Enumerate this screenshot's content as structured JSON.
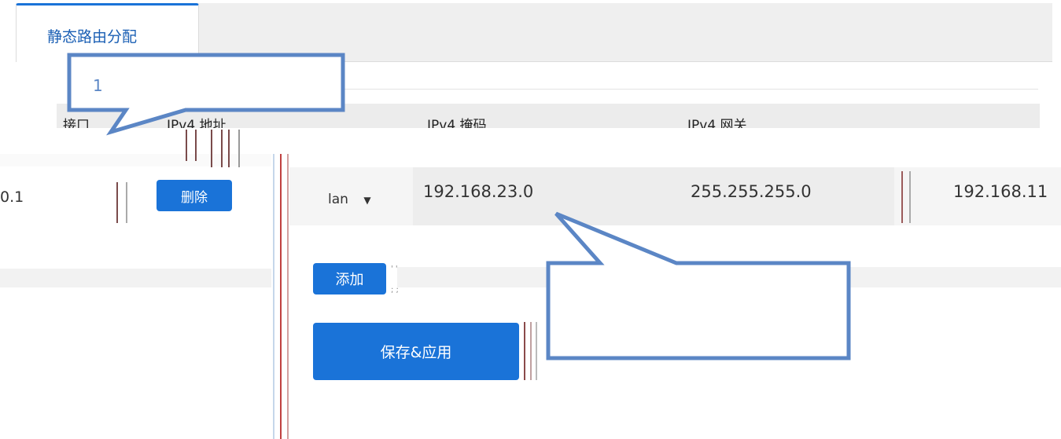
{
  "tabs": [
    {
      "label": "静态路由分配",
      "active": true
    }
  ],
  "table": {
    "headers": [
      "接口",
      "IPv4 地址",
      "IPv4 掩码",
      "IPv4 网关"
    ],
    "row": {
      "left_partial_value": "0.1",
      "delete_label": "删除",
      "interface": "lan",
      "address": "192.168.23.0",
      "mask": "255.255.255.0",
      "gateway_partial": "192.168.11"
    }
  },
  "actions": {
    "add_label": "添加",
    "save_label": "保存&应用"
  },
  "callouts": {
    "callout1_text": "1",
    "callout2_text": ""
  },
  "colors": {
    "primary": "#1a73d8",
    "callout_border": "#5b86c5"
  }
}
